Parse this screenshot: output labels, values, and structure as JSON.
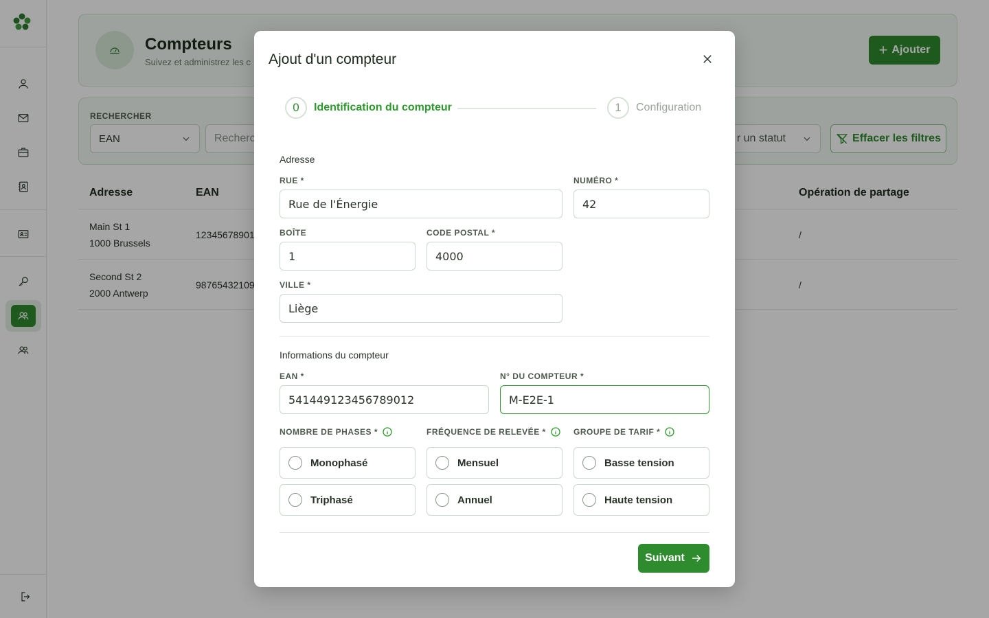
{
  "page": {
    "title": "Compteurs",
    "subtitle": "Suivez et administrez les c",
    "add_label": "Ajouter"
  },
  "filters": {
    "search_label": "RECHERCHER",
    "search_type": "EAN",
    "search_placeholder": "Recherch",
    "status_placeholder": "r un statut",
    "clear_label": "Effacer les filtres"
  },
  "table": {
    "headers": [
      "Adresse",
      "EAN",
      "Opération de partage"
    ],
    "rows": [
      {
        "address_line1": "Main St 1",
        "address_line2": "1000 Brussels",
        "ean": "12345678901",
        "partage": "/"
      },
      {
        "address_line1": "Second St 2",
        "address_line2": "2000 Antwerp",
        "ean": "98765432109",
        "partage": "/"
      }
    ]
  },
  "modal": {
    "title": "Ajout d'un compteur",
    "steps": [
      {
        "index": "0",
        "label": "Identification du compteur",
        "active": true
      },
      {
        "index": "1",
        "label": "Configuration",
        "active": false
      }
    ],
    "address_section": "Adresse",
    "fields": {
      "rue": {
        "label": "RUE *",
        "value": "Rue de l'Énergie"
      },
      "numero": {
        "label": "NUMÉRO *",
        "value": "42"
      },
      "boite": {
        "label": "BOÎTE",
        "value": "1"
      },
      "code_postal": {
        "label": "CODE POSTAL *",
        "value": "4000"
      },
      "ville": {
        "label": "VILLE *",
        "value": "Liège"
      },
      "ean": {
        "label": "EAN *",
        "value": "541449123456789012"
      },
      "numero_compteur": {
        "label": "N° DU COMPTEUR *",
        "value": "M-E2E-1"
      }
    },
    "meter_section": "Informations du compteur",
    "phases": {
      "label": "NOMBRE DE PHASES *",
      "options": [
        "Monophasé",
        "Triphasé"
      ]
    },
    "frequence": {
      "label": "FRÉQUENCE DE RELEVÉE *",
      "options": [
        "Mensuel",
        "Annuel"
      ]
    },
    "tarif": {
      "label": "GROUPE DE TARIF *",
      "options": [
        "Basse tension",
        "Haute tension"
      ]
    },
    "next_label": "Suivant"
  },
  "colors": {
    "accent": "#2e8b2e",
    "accent_light": "#f3f9f3"
  }
}
